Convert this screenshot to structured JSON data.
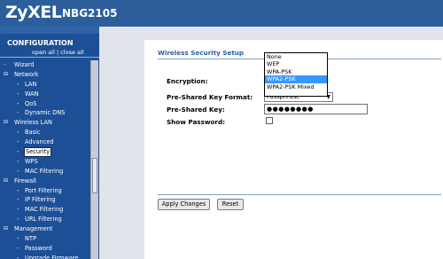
{
  "header": {
    "brand": "ZyXEL",
    "model": "NBG2105",
    "brand_color": "#2c5e9c"
  },
  "sidebar": {
    "title": "CONFIGURATION",
    "open_all": "open all",
    "separator": " | ",
    "close_all": "close all",
    "items": [
      {
        "label": "Wizard",
        "level": 0,
        "bullet": "-"
      },
      {
        "label": "Network",
        "level": 0,
        "bullet": "⊟"
      },
      {
        "label": "LAN",
        "level": 1,
        "bullet": "-"
      },
      {
        "label": "WAN",
        "level": 1,
        "bullet": "-"
      },
      {
        "label": "QoS",
        "level": 1,
        "bullet": "-"
      },
      {
        "label": "Dynamic DNS",
        "level": 1,
        "bullet": "-"
      },
      {
        "label": "Wireless LAN",
        "level": 0,
        "bullet": "⊟"
      },
      {
        "label": "Basic",
        "level": 1,
        "bullet": "-"
      },
      {
        "label": "Advanced",
        "level": 1,
        "bullet": "-"
      },
      {
        "label": "Security",
        "level": 1,
        "bullet": "-",
        "selected": true
      },
      {
        "label": "WPS",
        "level": 1,
        "bullet": "-"
      },
      {
        "label": "MAC Filtering",
        "level": 1,
        "bullet": "-"
      },
      {
        "label": "Firewall",
        "level": 0,
        "bullet": "⊟"
      },
      {
        "label": "Port Filtering",
        "level": 1,
        "bullet": "-"
      },
      {
        "label": "IP Filtering",
        "level": 1,
        "bullet": "-"
      },
      {
        "label": "MAC Filtering",
        "level": 1,
        "bullet": "-"
      },
      {
        "label": "URL Filtering",
        "level": 1,
        "bullet": "-"
      },
      {
        "label": "Management",
        "level": 0,
        "bullet": "⊟"
      },
      {
        "label": "NTP",
        "level": 1,
        "bullet": "-"
      },
      {
        "label": "Password",
        "level": 1,
        "bullet": "-"
      },
      {
        "label": "Upgrade Firmware",
        "level": 1,
        "bullet": "-"
      }
    ]
  },
  "main": {
    "section_title": "Wireless Security Setup",
    "fields": {
      "encryption_label": "Encryption:",
      "psk_format_label": "Pre-Shared Key Format:",
      "psk_label": "Pre-Shared Key:",
      "show_password_label": "Show Password:"
    },
    "encryption_dropdown": {
      "options": [
        "None",
        "WEP",
        "WPA-PSK",
        "WPA2-PSK",
        "WPA2-PSK Mixed"
      ],
      "highlighted": "WPA2-PSK"
    },
    "psk_format_select": {
      "value": "Passphrase"
    },
    "psk_value": "●●●●●●●●",
    "show_password_checked": false,
    "buttons": {
      "apply": "Apply Changes",
      "reset": "Reset"
    }
  }
}
